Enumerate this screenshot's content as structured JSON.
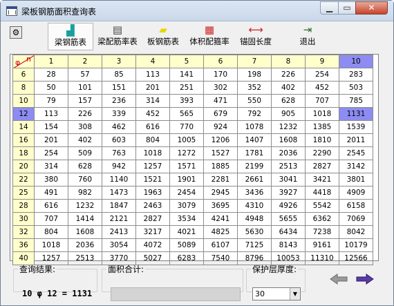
{
  "window": {
    "title": "梁板钢筋面积查询表"
  },
  "toolbar": {
    "buttons": [
      {
        "label": "梁钢筋表",
        "icon": "beam-rebar-icon",
        "color": "#1a9f9f",
        "active": true
      },
      {
        "label": "梁配筋率表",
        "icon": "beam-ratio-table-icon",
        "color": "#444444",
        "active": false
      },
      {
        "label": "板钢筋表",
        "icon": "slab-rebar-icon",
        "color": "#e6d800",
        "active": false
      },
      {
        "label": "体积配箍率",
        "icon": "stirrup-grid-icon",
        "color": "#cc2222",
        "active": false
      },
      {
        "label": "锚固长度",
        "icon": "anchor-length-icon",
        "color": "#cc2222",
        "active": false
      },
      {
        "label": "退出",
        "icon": "exit-door-icon",
        "color": "#2a6f2a",
        "active": false
      }
    ]
  },
  "table": {
    "corner": {
      "phi": "φ",
      "n": "n"
    },
    "columns": [
      "1",
      "2",
      "3",
      "4",
      "5",
      "6",
      "7",
      "8",
      "9",
      "10"
    ],
    "rows": [
      {
        "d": "6",
        "values": [
          "28",
          "57",
          "85",
          "113",
          "141",
          "170",
          "198",
          "226",
          "254",
          "283"
        ]
      },
      {
        "d": "8",
        "values": [
          "50",
          "101",
          "151",
          "201",
          "251",
          "302",
          "352",
          "402",
          "452",
          "503"
        ]
      },
      {
        "d": "10",
        "values": [
          "79",
          "157",
          "236",
          "314",
          "393",
          "471",
          "550",
          "628",
          "707",
          "785"
        ]
      },
      {
        "d": "12",
        "values": [
          "113",
          "226",
          "339",
          "452",
          "565",
          "679",
          "792",
          "905",
          "1018",
          "1131"
        ]
      },
      {
        "d": "14",
        "values": [
          "154",
          "308",
          "462",
          "616",
          "770",
          "924",
          "1078",
          "1232",
          "1385",
          "1539"
        ]
      },
      {
        "d": "16",
        "values": [
          "201",
          "402",
          "603",
          "804",
          "1005",
          "1206",
          "1407",
          "1608",
          "1810",
          "2011"
        ]
      },
      {
        "d": "18",
        "values": [
          "254",
          "509",
          "763",
          "1018",
          "1272",
          "1527",
          "1781",
          "2036",
          "2290",
          "2545"
        ]
      },
      {
        "d": "20",
        "values": [
          "314",
          "628",
          "942",
          "1257",
          "1571",
          "1885",
          "2199",
          "2513",
          "2827",
          "3142"
        ]
      },
      {
        "d": "22",
        "values": [
          "380",
          "760",
          "1140",
          "1521",
          "1901",
          "2281",
          "2661",
          "3041",
          "3421",
          "3801"
        ]
      },
      {
        "d": "25",
        "values": [
          "491",
          "982",
          "1473",
          "1963",
          "2454",
          "2945",
          "3436",
          "3927",
          "4418",
          "4909"
        ]
      },
      {
        "d": "28",
        "values": [
          "616",
          "1232",
          "1847",
          "2463",
          "3079",
          "3695",
          "4310",
          "4926",
          "5542",
          "6158"
        ]
      },
      {
        "d": "30",
        "values": [
          "707",
          "1414",
          "2121",
          "2827",
          "3534",
          "4241",
          "4948",
          "5655",
          "6362",
          "7069"
        ]
      },
      {
        "d": "32",
        "values": [
          "804",
          "1608",
          "2413",
          "3217",
          "4021",
          "4825",
          "5630",
          "6434",
          "7238",
          "8042"
        ]
      },
      {
        "d": "36",
        "values": [
          "1018",
          "2036",
          "3054",
          "4072",
          "5089",
          "6107",
          "7125",
          "8143",
          "9161",
          "10179"
        ]
      },
      {
        "d": "40",
        "values": [
          "1257",
          "2513",
          "3770",
          "5027",
          "6283",
          "7540",
          "8796",
          "10053",
          "11310",
          "12566"
        ]
      }
    ],
    "selected": {
      "row_d": "12",
      "col": "10"
    },
    "colors": {
      "header_bg": "#ffffcc",
      "selected_bg": "#8c8cf2"
    }
  },
  "query_result": {
    "label": "查询结果:",
    "value": "10 φ 12 = 1131"
  },
  "area_total": {
    "label": "面积合计:",
    "value": ""
  },
  "cover": {
    "label": "保护层厚度:",
    "value": "30"
  }
}
